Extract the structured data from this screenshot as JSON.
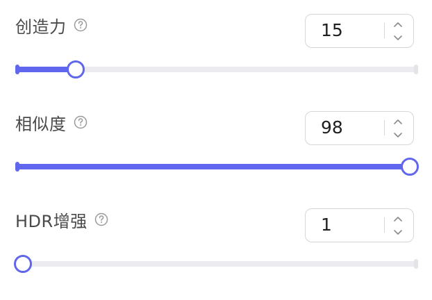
{
  "controls": [
    {
      "label": "创造力",
      "value": "15",
      "fraction": 0.15,
      "min_end_visible": true,
      "help_icon": "question-circle-icon",
      "stepper_up_icon": "chevron-up-icon",
      "stepper_down_icon": "chevron-down-icon"
    },
    {
      "label": "相似度",
      "value": "98",
      "fraction": 1.0,
      "min_end_visible": true,
      "help_icon": "question-circle-icon",
      "stepper_up_icon": "chevron-up-icon",
      "stepper_down_icon": "chevron-down-icon"
    },
    {
      "label": "HDR增强",
      "value": "1",
      "fraction": 0.0,
      "min_end_visible": false,
      "help_icon": "question-circle-icon",
      "stepper_up_icon": "chevron-up-icon",
      "stepper_down_icon": "chevron-down-icon"
    }
  ],
  "colors": {
    "accent": "#6066ee",
    "track": "#ececf0",
    "label_text": "#4a4a4a",
    "value_text": "#1f1f1f",
    "border": "#d6d6d6",
    "help_icon": "#9a9a9a"
  }
}
